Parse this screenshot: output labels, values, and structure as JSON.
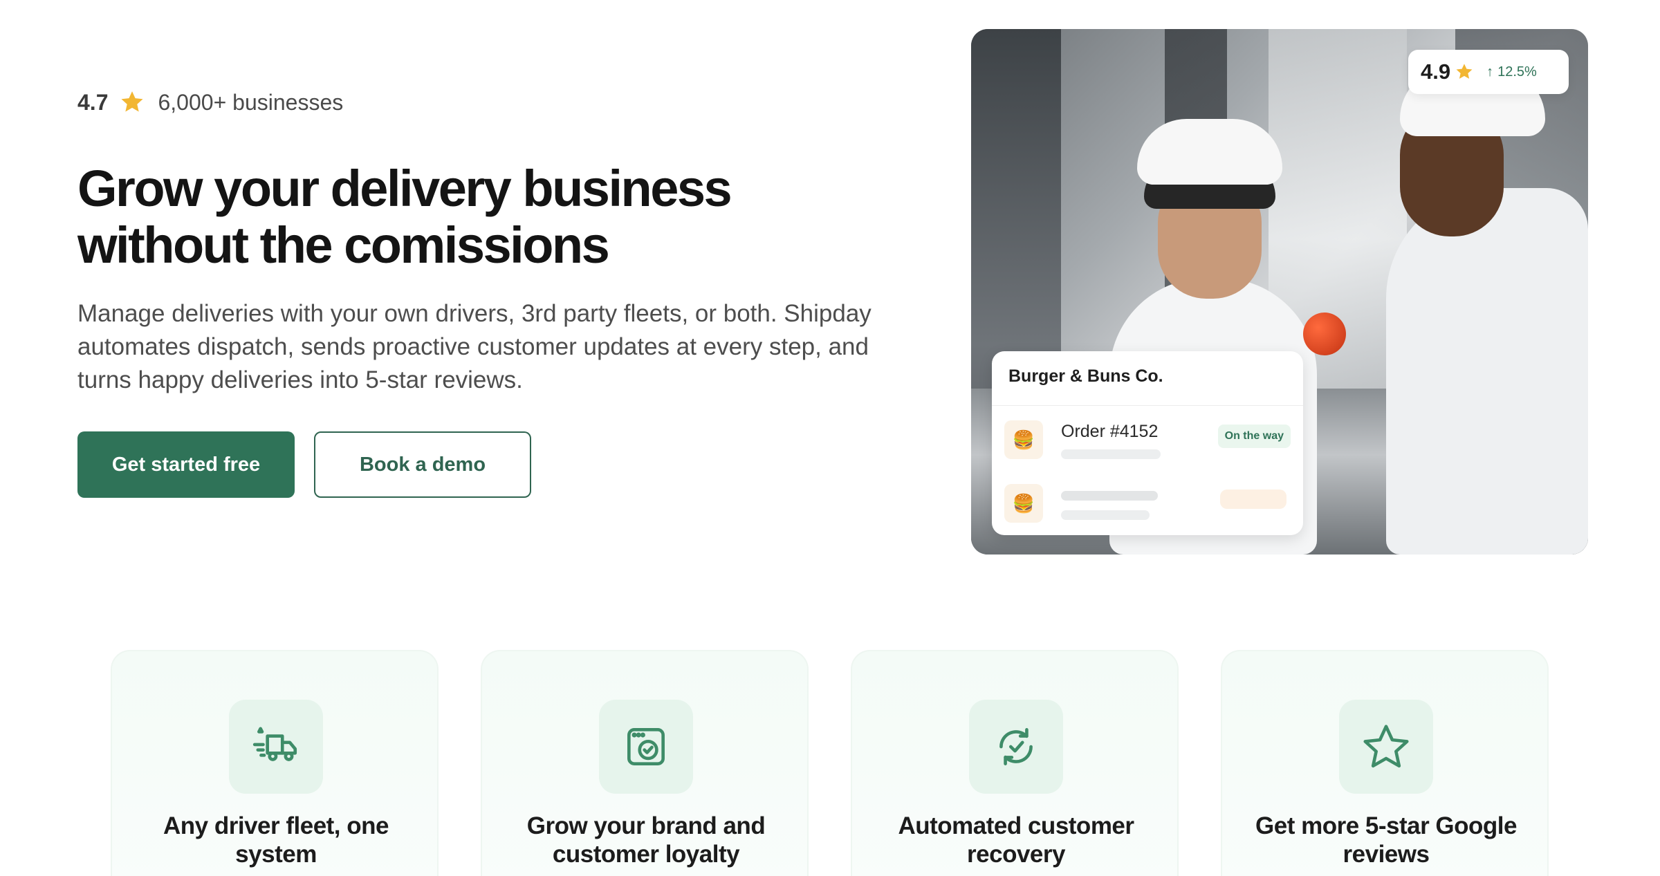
{
  "hero": {
    "rating_score": "4.7",
    "rating_text": "6,000+ businesses",
    "headline": "Grow your delivery business without the comissions",
    "subtext": "Manage deliveries with your own drivers, 3rd party fleets, or both. Shipday automates dispatch, sends proactive customer updates at every step, and turns happy deliveries into 5-star reviews.",
    "primary_cta": "Get started free",
    "secondary_cta": "Book a demo"
  },
  "stat_card": {
    "value": "4.9",
    "change": "12.5%"
  },
  "order_card": {
    "title": "Burger & Buns Co.",
    "order_number": "Order #4152",
    "status": "On the way"
  },
  "features": [
    {
      "title": "Any driver fleet, one system",
      "icon": "delivery-truck-icon"
    },
    {
      "title": "Grow your brand and customer loyalty",
      "icon": "brand-app-icon"
    },
    {
      "title": "Automated customer recovery",
      "icon": "refresh-check-icon"
    },
    {
      "title": "Get more 5-star Google reviews",
      "icon": "star-outline-icon"
    }
  ],
  "colors": {
    "brand_green": "#2f7358",
    "star_gold": "#f2b632",
    "feature_bg": "#f4fbf7"
  }
}
